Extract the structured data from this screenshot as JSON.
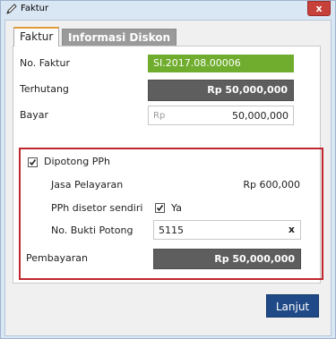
{
  "window": {
    "title": "Faktur",
    "close_label": "x"
  },
  "tabs": [
    {
      "label": "Faktur"
    },
    {
      "label": "Informasi Diskon"
    }
  ],
  "form": {
    "no_faktur": {
      "label": "No. Faktur",
      "value": "SI.2017.08.00006"
    },
    "terhutang": {
      "label": "Terhutang",
      "value": "Rp 50,000,000"
    },
    "bayar": {
      "label": "Bayar",
      "prefix": "Rp",
      "value": "50,000,000"
    },
    "pph": {
      "checkbox_label": "Dipotong PPh",
      "checked": true,
      "jasa_label": "Jasa Pelayaran",
      "jasa_value": "Rp 600,000",
      "disetor_label": "PPh disetor sendiri",
      "disetor_option": "Ya",
      "bukti_label": "No. Bukti Potong",
      "bukti_value": "5115",
      "clear_icon": "x"
    },
    "pembayaran": {
      "label": "Pembayaran",
      "value": "Rp 50,000,000"
    }
  },
  "buttons": {
    "next": "Lanjut"
  },
  "colors": {
    "accent_green": "#70ad2e",
    "dark_field": "#5e5e5e",
    "highlight_border": "#c0262e",
    "primary_button": "#204a87"
  }
}
